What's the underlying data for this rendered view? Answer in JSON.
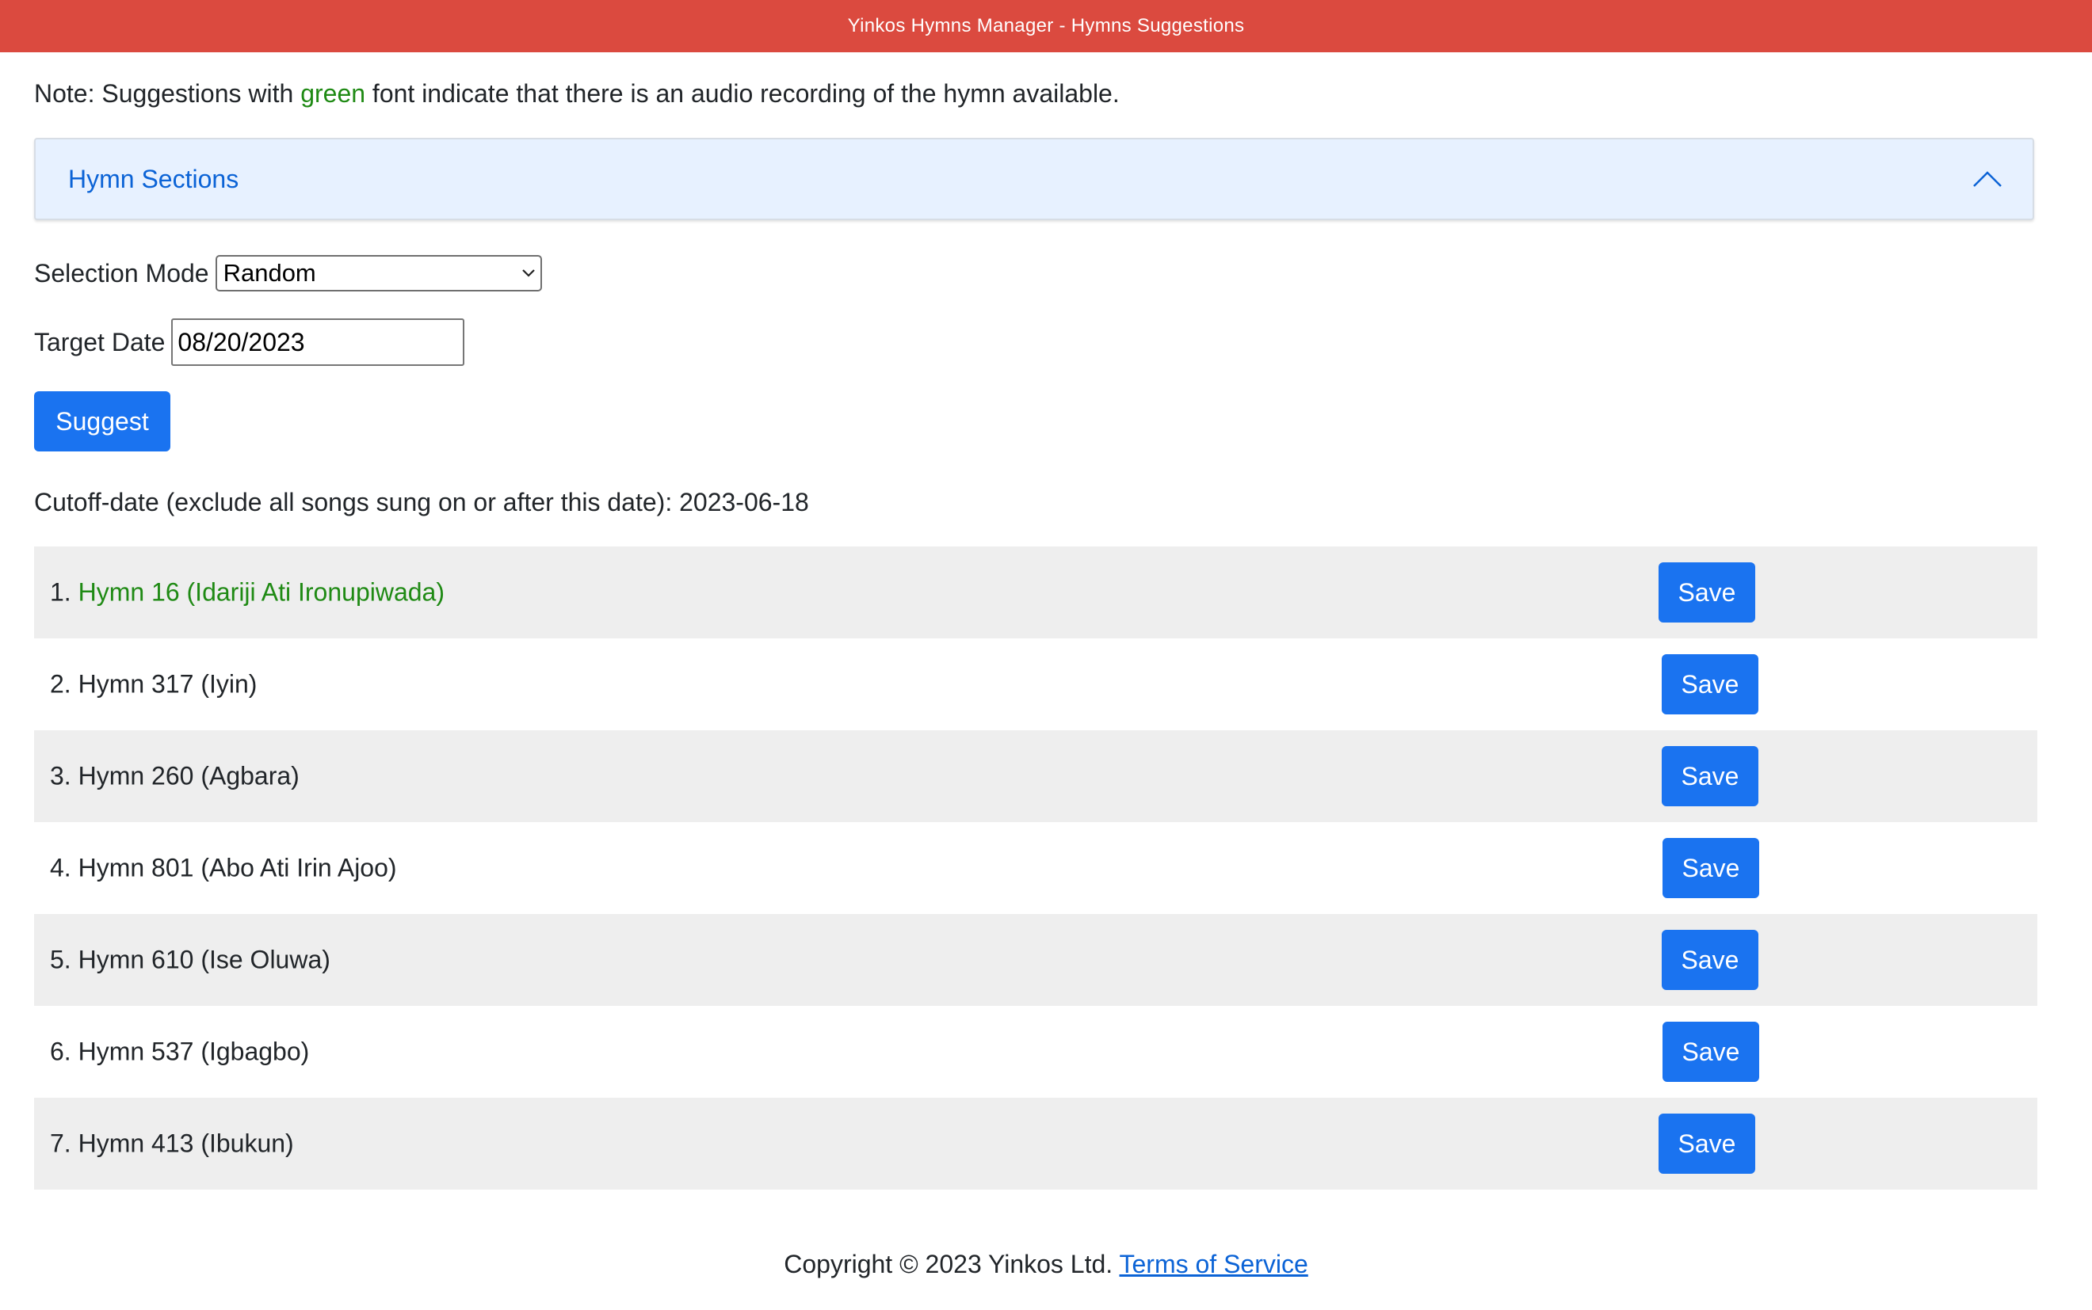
{
  "header": {
    "title": "Yinkos Hymns Manager - Hymns Suggestions"
  },
  "note": {
    "prefix": "Note: Suggestions with ",
    "highlight": "green",
    "suffix": " font indicate that there is an audio recording of the hymn available."
  },
  "accordion": {
    "title": "Hymn Sections",
    "expanded": true
  },
  "form": {
    "selection_mode_label": "Selection Mode",
    "selection_mode_value": "Random",
    "target_date_label": "Target Date",
    "target_date_value": "08/20/2023",
    "suggest_label": "Suggest"
  },
  "cutoff": {
    "text": "Cutoff-date (exclude all songs sung on or after this date): 2023-06-18"
  },
  "suggestions": [
    {
      "number": "1.",
      "title": "Hymn 16 (Idariji Ati Ironupiwada)",
      "has_audio": true,
      "save_label": "Save"
    },
    {
      "number": "2.",
      "title": "Hymn 317 (Iyin)",
      "has_audio": false,
      "save_label": "Save"
    },
    {
      "number": "3.",
      "title": "Hymn 260 (Agbara)",
      "has_audio": false,
      "save_label": "Save"
    },
    {
      "number": "4.",
      "title": "Hymn 801 (Abo Ati Irin Ajoo)",
      "has_audio": false,
      "save_label": "Save"
    },
    {
      "number": "5.",
      "title": "Hymn 610 (Ise Oluwa)",
      "has_audio": false,
      "save_label": "Save"
    },
    {
      "number": "6.",
      "title": "Hymn 537 (Igbagbo)",
      "has_audio": false,
      "save_label": "Save"
    },
    {
      "number": "7.",
      "title": "Hymn 413 (Ibukun)",
      "has_audio": false,
      "save_label": "Save"
    }
  ],
  "footer": {
    "copyright": "Copyright © 2023 Yinkos Ltd.",
    "tos_link": "Terms of Service"
  },
  "colors": {
    "header_bg": "#db4a3f",
    "accent_blue": "#1a73f0",
    "audio_green": "#1f8a14",
    "accordion_bg": "#e7f1ff"
  },
  "icons": {
    "accordion_toggle": "chevron-up-icon",
    "select_arrow": "chevron-down-icon"
  }
}
